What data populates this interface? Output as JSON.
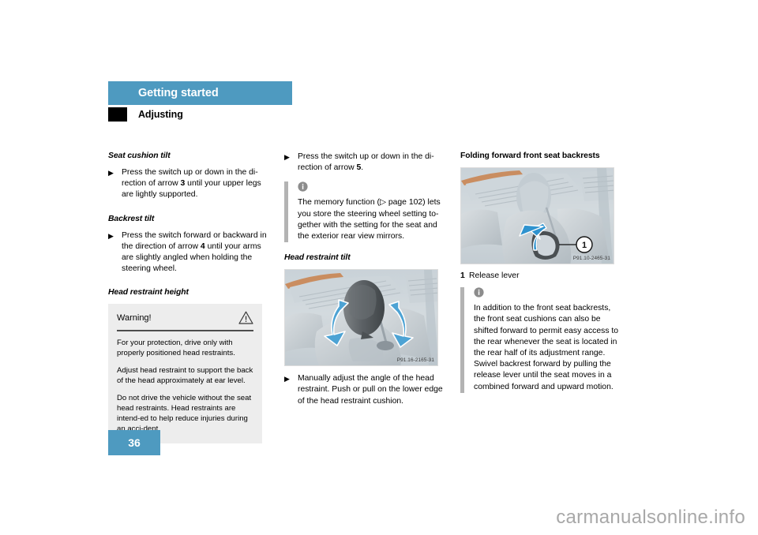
{
  "header": {
    "chapter": "Getting started",
    "section": "Adjusting",
    "accent_color": "#4e9ac0"
  },
  "page_number": "36",
  "watermark": "carmanualsonline.info",
  "left_column": {
    "headings": {
      "seat_cushion_tilt": "Seat cushion tilt",
      "backrest_tilt": "Backrest tilt",
      "head_restraint_height": "Head restraint height"
    },
    "bullets": [
      {
        "glyph": "▶",
        "pre": "Press the switch up or down in the di-rection of arrow ",
        "num": "3",
        "post": " until your upper legs are lightly supported."
      },
      {
        "glyph": "▶",
        "pre": "Press the switch forward or backward in the direction of arrow ",
        "num": "4",
        "post": " until your arms are slightly angled when holding the steering wheel."
      }
    ],
    "warning": {
      "title": "Warning!",
      "icon": "warning-triangle-icon",
      "paragraphs": [
        "For your protection, drive only with properly positioned head restraints.",
        "Adjust head restraint to support the back of the head approximately at ear level.",
        "Do not drive the vehicle without the seat head restraints. Head restraints are intend-ed to help reduce injuries during an acci-dent."
      ]
    }
  },
  "middle_column": {
    "bullet_top": {
      "glyph": "▶",
      "pre": "Press the switch up or down in the di-rection of arrow ",
      "num": "5",
      "post": "."
    },
    "note": {
      "icon": "info-icon",
      "text": "The memory function (▷ page 102) lets you store the steering wheel setting to-gether with the setting for the seat and the exterior rear view mirrors."
    },
    "heading": "Head restraint tilt",
    "figure": {
      "caption": "P91.16-2165-31",
      "alt": "head-restraint-tilt-photo"
    },
    "bullet_bottom": {
      "glyph": "▶",
      "text": "Manually adjust the angle of the head restraint. Push or pull on the lower edge of the head restraint cushion."
    }
  },
  "right_column": {
    "heading": "Folding forward front seat backrests",
    "figure": {
      "caption": "P91.10-2465-31",
      "callout": "1",
      "alt": "seat-backrest-release-lever-photo"
    },
    "legend": [
      {
        "num": "1",
        "label": "Release lever"
      }
    ],
    "note": {
      "icon": "info-icon",
      "text": "In addition to the front seat backrests, the front seat cushions can also be shifted forward to permit easy access to the rear whenever the seat is located in the rear half of its adjustment range. Swivel backrest forward by pulling the release lever until the seat moves in a combined forward and upward motion."
    }
  }
}
